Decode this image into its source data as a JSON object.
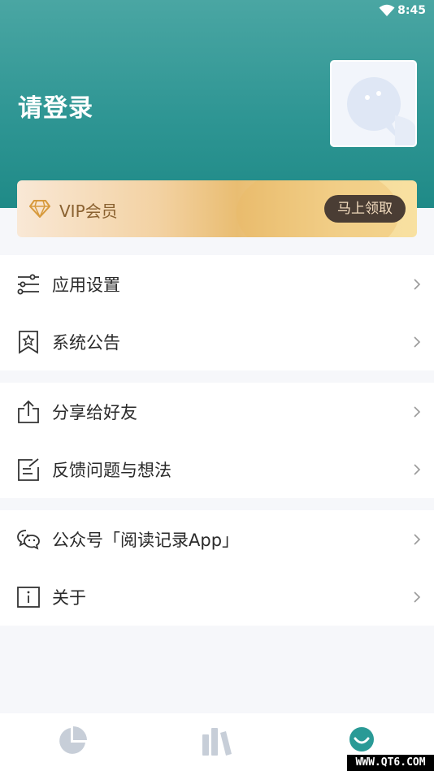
{
  "status_bar": {
    "time": "8:45"
  },
  "header": {
    "title": "请登录"
  },
  "vip": {
    "label": "VIP会员",
    "button": "马上领取"
  },
  "menu": {
    "group1": [
      {
        "label": "应用设置",
        "icon": "sliders-icon"
      },
      {
        "label": "系统公告",
        "icon": "bookmark-star-icon"
      }
    ],
    "group2": [
      {
        "label": "分享给好友",
        "icon": "share-icon"
      },
      {
        "label": "反馈问题与想法",
        "icon": "feedback-edit-icon"
      }
    ],
    "group3": [
      {
        "label": "公众号「阅读记录App」",
        "icon": "wechat-icon"
      },
      {
        "label": "关于",
        "icon": "info-icon"
      }
    ]
  },
  "tabbar": {
    "tabs": [
      {
        "icon": "pie-chart-icon",
        "active": false
      },
      {
        "icon": "books-icon",
        "active": false
      },
      {
        "icon": "profile-icon",
        "active": true
      }
    ]
  },
  "watermark": {
    "text": "WWW.QT6.COM"
  },
  "colors": {
    "header_teal": "#2f9694",
    "active_tab": "#2a9a96",
    "inactive_tab": "#c7ced8",
    "vip_text": "#8a6130",
    "vip_button_bg": "#4a3d34"
  }
}
